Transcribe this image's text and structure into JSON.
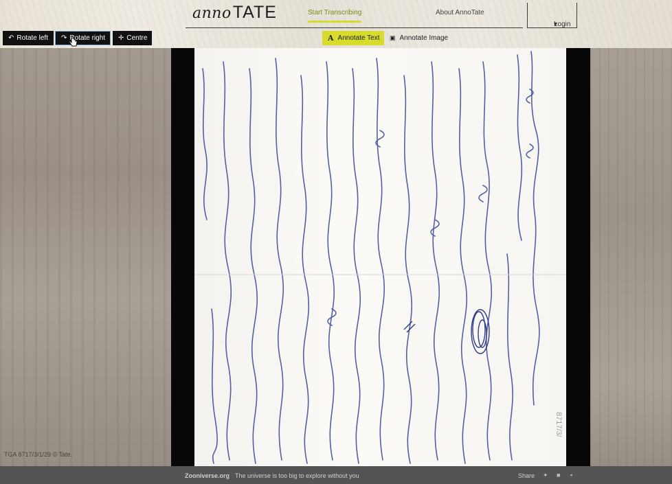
{
  "header": {
    "logo_script": "anno",
    "logo_text": "TATE",
    "nav": {
      "start": "Start Transcribing",
      "about": "About AnnoTate"
    },
    "login": "Login"
  },
  "toolbar": {
    "rotate_left": "Rotate left",
    "rotate_right": "Rotate right",
    "centre": "Centre"
  },
  "modes": {
    "annotate_text": "Annotate Text",
    "annotate_image": "Annotate Image",
    "active": "annotate_text"
  },
  "document": {
    "margin_number": "8717/3/",
    "credit": "TGA 8717/3/1/29 © Tate."
  },
  "footer": {
    "org": "Zooniverse.org",
    "tagline": "The universe is too big to explore without you",
    "share": "Share"
  },
  "colors": {
    "accent": "#d6db2c",
    "nav_active": "#7a8a14",
    "ink": "#3f4fa0",
    "footer_bg": "#545454",
    "toolbar_bg": "#111111"
  },
  "icons": {
    "rotate_left": "rotate-left-icon",
    "rotate_right": "rotate-right-icon",
    "centre": "crosshair-icon",
    "annotate_text": "text-icon",
    "annotate_image": "image-icon",
    "twitter": "twitter-icon",
    "facebook": "facebook-icon",
    "google_plus": "google-plus-icon"
  }
}
